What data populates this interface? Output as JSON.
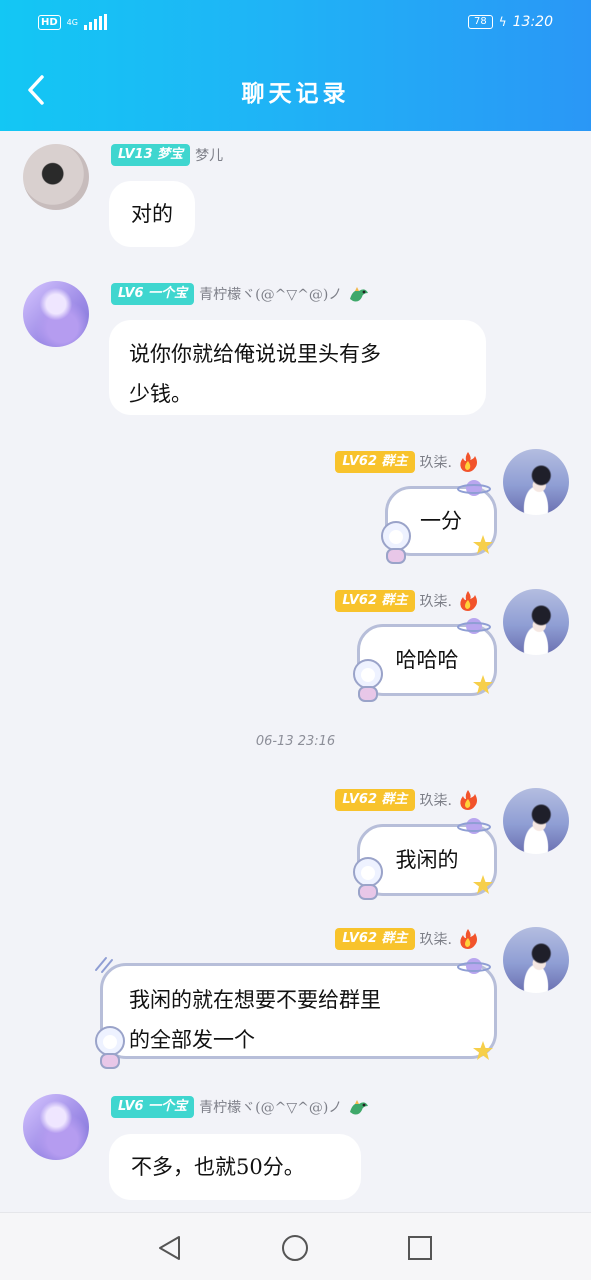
{
  "status_bar": {
    "hd": "HD",
    "network": "4G",
    "battery": "78",
    "time": "13:20"
  },
  "header": {
    "title": "聊天记录"
  },
  "messages": [
    {
      "badge": "LV13 梦宝",
      "nickname": "梦儿",
      "text": "对的"
    },
    {
      "badge": "LV6 一个宝",
      "nickname": "青柠檬ヾ(@^▽^@)ノ",
      "lines": [
        "说你你就给俺说说里头有多",
        "少钱。"
      ]
    },
    {
      "badge": "LV62 群主",
      "nickname": "玖柒.",
      "text": "一分"
    },
    {
      "badge": "LV62 群主",
      "nickname": "玖柒.",
      "text": "哈哈哈"
    },
    {
      "badge": "LV62 群主",
      "nickname": "玖柒.",
      "text": "我闲的"
    },
    {
      "badge": "LV62 群主",
      "nickname": "玖柒.",
      "lines": [
        "我闲的就在想要不要给群里",
        "的全部发一个"
      ]
    },
    {
      "badge": "LV6 一个宝",
      "nickname": "青柠檬ヾ(@^▽^@)ノ",
      "text": "不多，也就50分。"
    }
  ],
  "timestamp": "06-13 23:16",
  "colors": {
    "header_start": "#13c7f4",
    "header_end": "#2a97f6",
    "badge_teal": "#3fd6cf",
    "badge_gold": "#f8c32c",
    "background": "#f2f3f8"
  },
  "icons": {
    "back": "chevron-left-icon",
    "fire": "fire-icon",
    "dragon": "dragon-icon",
    "nav_back": "triangle-back-icon",
    "nav_home": "circle-home-icon",
    "nav_recent": "square-recent-icon"
  }
}
